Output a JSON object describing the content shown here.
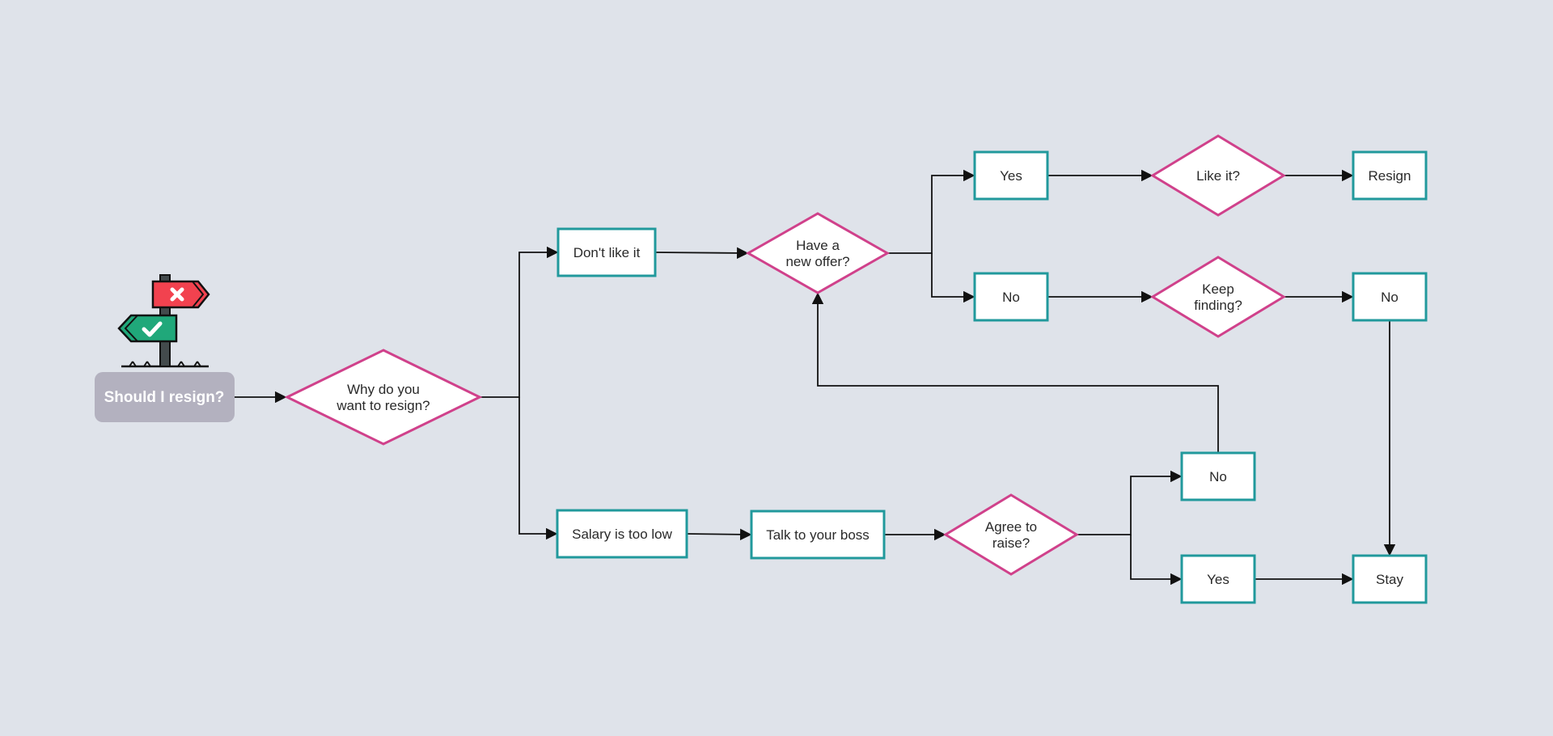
{
  "diagram": {
    "title": "Should I resign?",
    "start": {
      "id": "start",
      "label": "Should I resign?",
      "icon": "signpost-icon",
      "color": "#b3b1bf"
    },
    "colors": {
      "background": "#dfe3ea",
      "process_border": "#21999c",
      "decision_border": "#d0418b",
      "connector": "#111111"
    },
    "nodes": [
      {
        "id": "why",
        "type": "decision",
        "lines": [
          "Why do you",
          "want to resign?"
        ]
      },
      {
        "id": "dontlike",
        "type": "process",
        "lines": [
          "Don't like it"
        ]
      },
      {
        "id": "salary",
        "type": "process",
        "lines": [
          "Salary is too low"
        ]
      },
      {
        "id": "offer",
        "type": "decision",
        "lines": [
          "Have a",
          "new offer?"
        ]
      },
      {
        "id": "yes1",
        "type": "process",
        "lines": [
          "Yes"
        ]
      },
      {
        "id": "no1",
        "type": "process",
        "lines": [
          "No"
        ]
      },
      {
        "id": "likeit",
        "type": "decision",
        "lines": [
          "Like it?"
        ]
      },
      {
        "id": "keep",
        "type": "decision",
        "lines": [
          "Keep",
          "finding?"
        ]
      },
      {
        "id": "resign",
        "type": "process",
        "lines": [
          "Resign"
        ]
      },
      {
        "id": "no2",
        "type": "process",
        "lines": [
          "No"
        ]
      },
      {
        "id": "boss",
        "type": "process",
        "lines": [
          "Talk to your boss"
        ]
      },
      {
        "id": "agree",
        "type": "decision",
        "lines": [
          "Agree to",
          "raise?"
        ]
      },
      {
        "id": "no3",
        "type": "process",
        "lines": [
          "No"
        ]
      },
      {
        "id": "yes2",
        "type": "process",
        "lines": [
          "Yes"
        ]
      },
      {
        "id": "stay",
        "type": "process",
        "lines": [
          "Stay"
        ]
      }
    ],
    "edges": [
      {
        "from": "start",
        "to": "why"
      },
      {
        "from": "why",
        "to": "dontlike"
      },
      {
        "from": "why",
        "to": "salary"
      },
      {
        "from": "dontlike",
        "to": "offer"
      },
      {
        "from": "offer",
        "to": "yes1"
      },
      {
        "from": "offer",
        "to": "no1"
      },
      {
        "from": "yes1",
        "to": "likeit"
      },
      {
        "from": "no1",
        "to": "keep"
      },
      {
        "from": "likeit",
        "to": "resign"
      },
      {
        "from": "keep",
        "to": "no2"
      },
      {
        "from": "no2",
        "to": "stay"
      },
      {
        "from": "salary",
        "to": "boss"
      },
      {
        "from": "boss",
        "to": "agree"
      },
      {
        "from": "agree",
        "to": "no3"
      },
      {
        "from": "agree",
        "to": "yes2"
      },
      {
        "from": "no3",
        "to": "offer"
      },
      {
        "from": "yes2",
        "to": "stay"
      }
    ]
  }
}
